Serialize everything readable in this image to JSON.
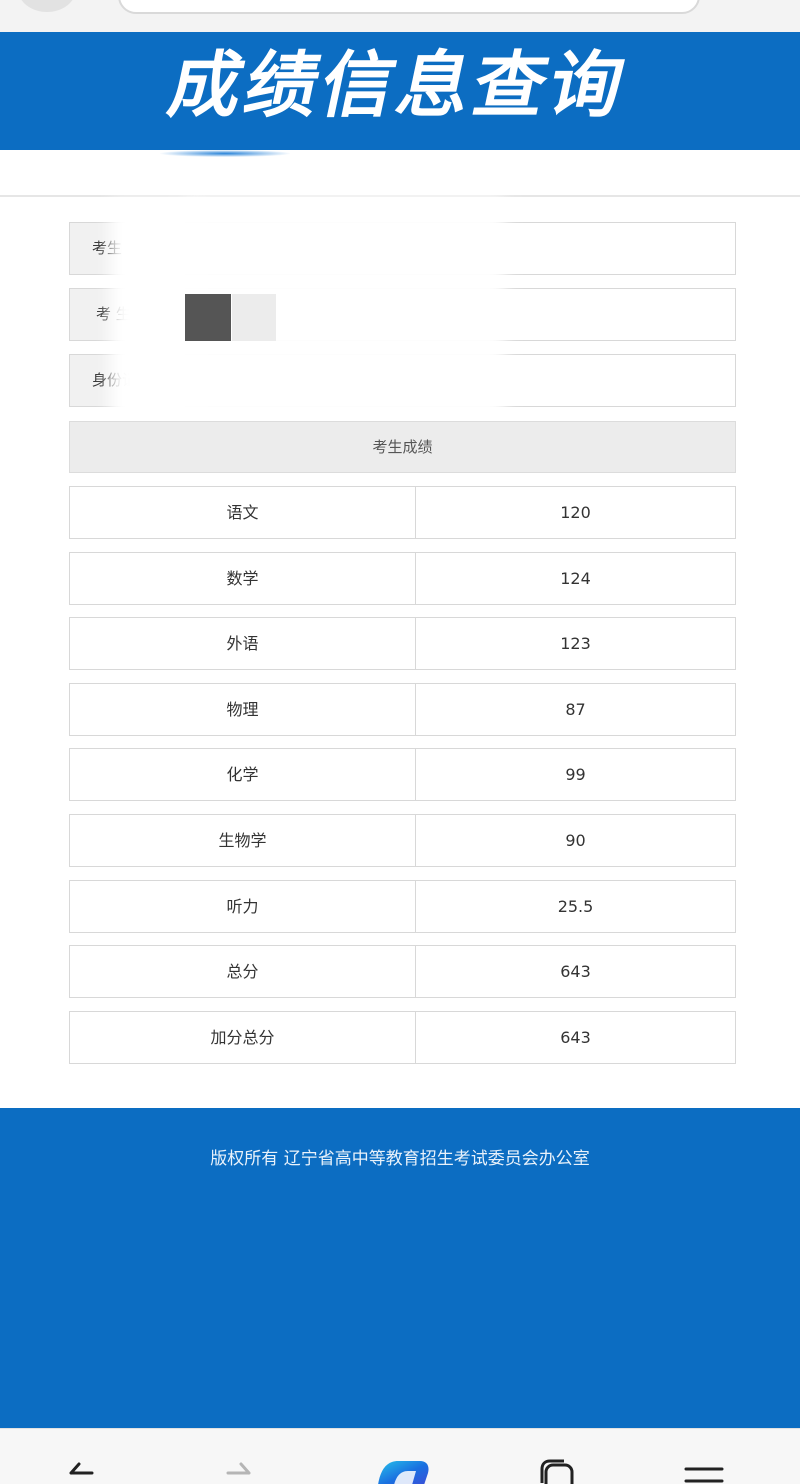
{
  "banner": {
    "title": "成绩信息查询"
  },
  "info": {
    "name_label": "考生",
    "number_label": "考 生",
    "id_label": "身份证"
  },
  "scores_header": "考生成绩",
  "scores": [
    {
      "subject": "语文",
      "score": "120"
    },
    {
      "subject": "数学",
      "score": "124"
    },
    {
      "subject": "外语",
      "score": "123"
    },
    {
      "subject": "物理",
      "score": "87"
    },
    {
      "subject": "化学",
      "score": "99"
    },
    {
      "subject": "生物学",
      "score": "90"
    },
    {
      "subject": "听力",
      "score": "25.5"
    },
    {
      "subject": "总分",
      "score": "643"
    },
    {
      "subject": "加分总分",
      "score": "643"
    }
  ],
  "footer": {
    "copyright": "版权所有 辽宁省高中等教育招生考试委员会办公室"
  },
  "nav": {
    "icons": [
      "back-arrow-icon",
      "forward-arrow-icon",
      "copilot-icon",
      "tabs-icon",
      "menu-icon"
    ]
  },
  "colors": {
    "brand_blue": "#0c6dc2"
  }
}
